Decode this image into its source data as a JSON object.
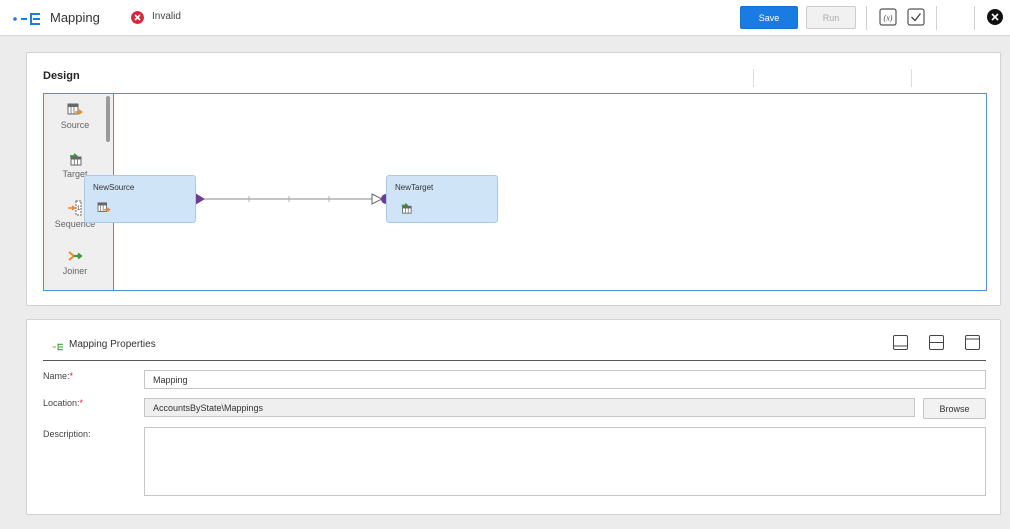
{
  "header": {
    "app_title": "Mapping",
    "status": "Invalid",
    "save_label": "Save",
    "run_label": "Run"
  },
  "colors": {
    "accent": "#1a7ce3",
    "error": "#d5263b",
    "node_fill": "#cfe4f7",
    "link": "#6a3e97"
  },
  "icons": [
    "mapping-icon",
    "invalid-status-icon",
    "expression-icon",
    "validate-icon",
    "close-icon"
  ],
  "design": {
    "title": "Design",
    "palette": [
      {
        "label": "Source",
        "icon": "source-icon"
      },
      {
        "label": "Target",
        "icon": "target-icon"
      },
      {
        "label": "Sequence",
        "icon": "sequence-icon"
      },
      {
        "label": "Joiner",
        "icon": "joiner-icon"
      }
    ],
    "nodes": [
      {
        "label": "NewSource",
        "icon": "source-icon"
      },
      {
        "label": "NewTarget",
        "icon": "target-icon"
      }
    ]
  },
  "properties": {
    "title": "Mapping Properties",
    "fields": {
      "name_label": "Name:",
      "name_value": "Mapping",
      "location_label": "Location:",
      "location_value": "AccountsByState\\Mappings",
      "description_label": "Description:",
      "description_value": ""
    },
    "browse_label": "Browse",
    "required_mark": "*"
  }
}
